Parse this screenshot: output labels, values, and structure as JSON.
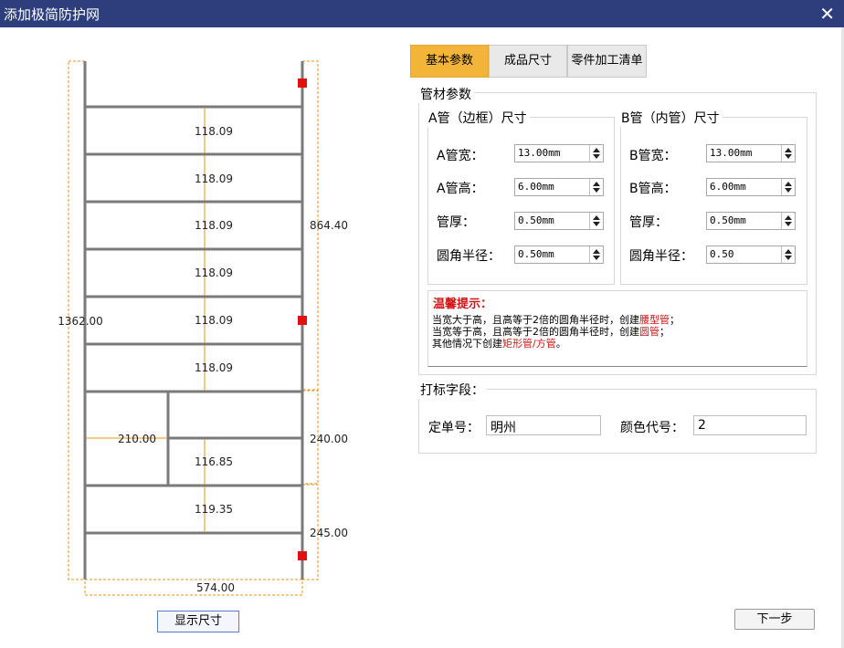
{
  "window": {
    "title": "添加极简防护网",
    "close_glyph": "✕"
  },
  "drawing": {
    "dimensions": {
      "total_height": "1362.00",
      "right_upper": "864.40",
      "right_middle": "240.00",
      "right_lower": "245.00",
      "bottom_width": "574.00",
      "inner_width": "210.00",
      "gap_1": "118.09",
      "gap_2": "118.09",
      "gap_3": "118.09",
      "gap_4": "118.09",
      "gap_5": "118.09",
      "gap_6": "118.09",
      "gap_7": "116.85",
      "gap_8": "119.35"
    },
    "marker_color": "#e31010",
    "dim_color": "#e8921a"
  },
  "buttons": {
    "show_dimensions": "显示尺寸",
    "next": "下一步"
  },
  "tabs": [
    {
      "label": "基本参数",
      "active": true
    },
    {
      "label": "成品尺寸",
      "active": false
    },
    {
      "label": "零件加工清单",
      "active": false
    }
  ],
  "pipe_params": {
    "title": "管材参数",
    "a_pipe": {
      "title": "A管（边框）尺寸",
      "width_label": "A管宽：",
      "width_value": "13.00mm",
      "height_label": "A管高：",
      "height_value": "6.00mm",
      "thickness_label": "管厚：",
      "thickness_value": "0.50mm",
      "radius_label": "圆角半径：",
      "radius_value": "0.50mm"
    },
    "b_pipe": {
      "title": "B管（内管）尺寸",
      "width_label": "B管宽：",
      "width_value": "13.00mm",
      "height_label": "B管高：",
      "height_value": "6.00mm",
      "thickness_label": "管厚：",
      "thickness_value": "0.50mm",
      "radius_label": "圆角半径：",
      "radius_value": "0.50"
    },
    "notice": {
      "heading": "温馨提示：",
      "line1_prefix": "当宽大于高，且高等于2倍的圆角半径时，创建",
      "line1_red": "腰型管",
      "line1_suffix": "；",
      "line2_prefix": "当宽等于高，且高等于2倍的圆角半径时，创建",
      "line2_red": "圆管",
      "line2_suffix": "；",
      "line3_prefix": "其他情况下创建",
      "line3_red": "矩形管/方管",
      "line3_suffix": "。"
    }
  },
  "marking": {
    "title": "打标字段：",
    "order_label": "定单号：",
    "order_value": "明州",
    "color_label": "颜色代号：",
    "color_value": "2"
  }
}
